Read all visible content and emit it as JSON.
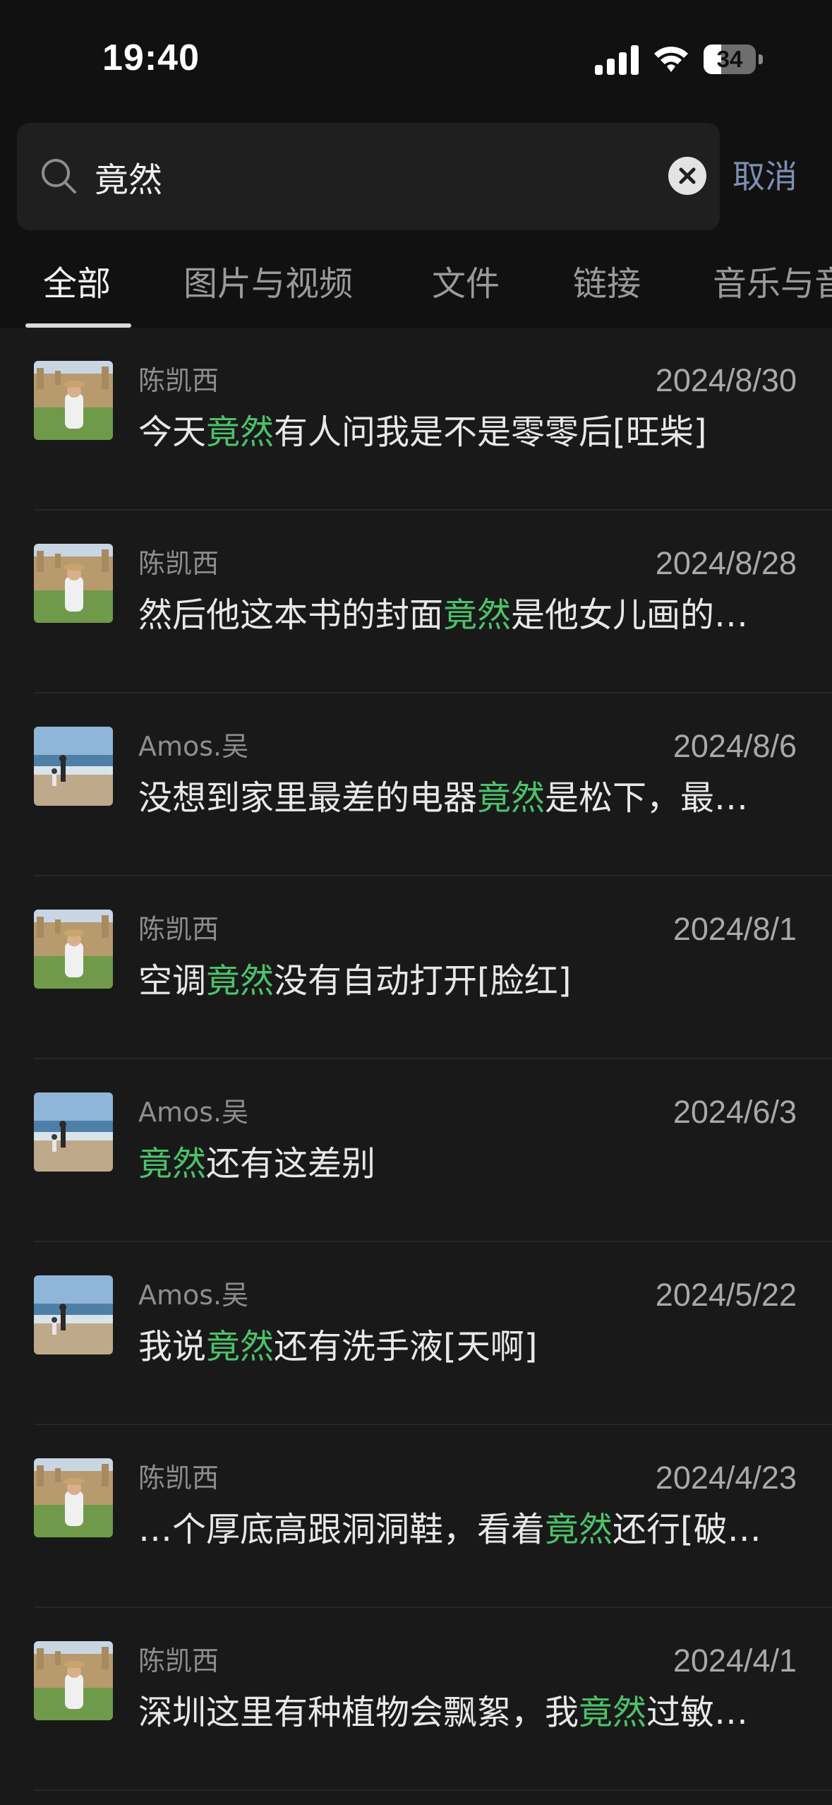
{
  "status_bar": {
    "time": "19:40",
    "battery": "34",
    "battery_fraction": 0.34,
    "icons": [
      "signal-icon",
      "wifi-icon",
      "battery-icon"
    ]
  },
  "search": {
    "query": "竟然",
    "cancel_label": "取消",
    "icons": [
      "search-icon",
      "clear-icon"
    ]
  },
  "tabs": [
    {
      "label": "全部",
      "active": true
    },
    {
      "label": "图片与视频",
      "active": false
    },
    {
      "label": "文件",
      "active": false
    },
    {
      "label": "链接",
      "active": false
    },
    {
      "label": "音乐与音",
      "active": false
    }
  ],
  "colors": {
    "highlight": "#4cc26a",
    "cancel": "#7d90b3",
    "background": "#191919"
  },
  "results": [
    {
      "sender": "陈凯西",
      "date": "2024/8/30",
      "avatar": "avatar-chenkaixi",
      "before": "今天",
      "match": "竟然",
      "after": "有人问我是不是零零后[旺柴]"
    },
    {
      "sender": "陈凯西",
      "date": "2024/8/28",
      "avatar": "avatar-chenkaixi",
      "before": "然后他这本书的封面",
      "match": "竟然",
      "after": "是他女儿画的…"
    },
    {
      "sender": "Amos.吴",
      "date": "2024/8/6",
      "avatar": "avatar-amos",
      "before": "没想到家里最差的电器",
      "match": "竟然",
      "after": "是松下，最…"
    },
    {
      "sender": "陈凯西",
      "date": "2024/8/1",
      "avatar": "avatar-chenkaixi",
      "before": "空调",
      "match": "竟然",
      "after": "没有自动打开[脸红]"
    },
    {
      "sender": "Amos.吴",
      "date": "2024/6/3",
      "avatar": "avatar-amos",
      "before": "",
      "match": "竟然",
      "after": "还有这差别"
    },
    {
      "sender": "Amos.吴",
      "date": "2024/5/22",
      "avatar": "avatar-amos",
      "before": "我说",
      "match": "竟然",
      "after": "还有洗手液[天啊]"
    },
    {
      "sender": "陈凯西",
      "date": "2024/4/23",
      "avatar": "avatar-chenkaixi",
      "before": "…个厚底高跟洞洞鞋，看着",
      "match": "竟然",
      "after": "还行[破…"
    },
    {
      "sender": "陈凯西",
      "date": "2024/4/1",
      "avatar": "avatar-chenkaixi",
      "before": "深圳这里有种植物会飘絮，我",
      "match": "竟然",
      "after": "过敏…"
    }
  ]
}
